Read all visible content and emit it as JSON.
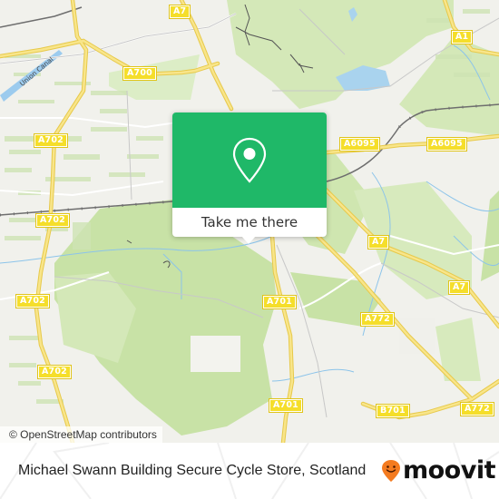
{
  "map": {
    "attribution": "© OpenStreetMap contributors",
    "road_labels": [
      {
        "id": "a7-top",
        "text": "A7"
      },
      {
        "id": "a1",
        "text": "A1"
      },
      {
        "id": "a700",
        "text": "A700"
      },
      {
        "id": "a702-1",
        "text": "A702"
      },
      {
        "id": "a6095-1",
        "text": "A6095"
      },
      {
        "id": "a6095-2",
        "text": "A6095"
      },
      {
        "id": "a702-2",
        "text": "A702"
      },
      {
        "id": "a7-mid",
        "text": "A7"
      },
      {
        "id": "a7-right",
        "text": "A7"
      },
      {
        "id": "a702-3",
        "text": "A702"
      },
      {
        "id": "a701-1",
        "text": "A701"
      },
      {
        "id": "a772-1",
        "text": "A772"
      },
      {
        "id": "a702-4",
        "text": "A702"
      },
      {
        "id": "a701-2",
        "text": "A701"
      },
      {
        "id": "b701",
        "text": "B701"
      },
      {
        "id": "a772-2",
        "text": "A772"
      }
    ],
    "water_labels": [
      {
        "id": "union-canal",
        "text": "Union Canal"
      }
    ],
    "colors": {
      "background": "#f1f1ec",
      "park": "#cfe6b0",
      "wood": "#bddc9a",
      "water": "#a9d3ee",
      "road_major": "#f5de5a",
      "road_minor": "#ffffff",
      "railway": "#707070"
    }
  },
  "popup": {
    "icon": "location-pin-icon",
    "button_label": "Take me there",
    "color": "#1fb868"
  },
  "footer": {
    "title": "Michael Swann Building Secure Cycle Store, Scotland",
    "brand": "moovit",
    "brand_icon": "moovit-smiley-pin-icon",
    "brand_color": "#f47b20"
  }
}
